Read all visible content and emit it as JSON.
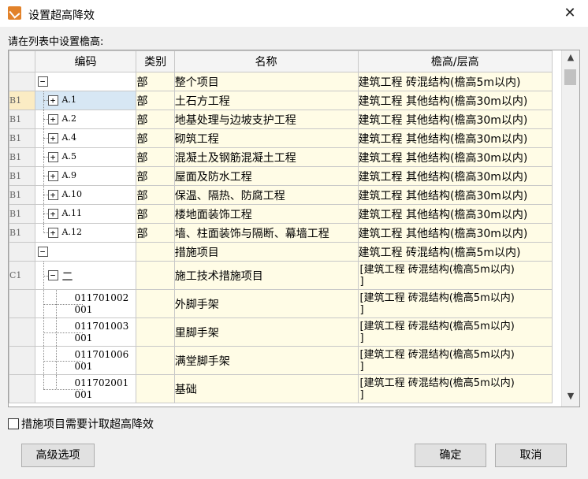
{
  "window": {
    "title": "设置超高降效",
    "close": "✕"
  },
  "prompt": "请在列表中设置檐高:",
  "columns": {
    "code": "编码",
    "type": "类别",
    "name": "名称",
    "height": "檐高/层高"
  },
  "rows": [
    {
      "label": "",
      "toggle": "−",
      "code": "",
      "type": "部",
      "name": "整个项目",
      "height": "建筑工程 砖混结构(檐高5m以内)"
    },
    {
      "label": "B1",
      "toggle": "+",
      "code": "A.1",
      "type": "部",
      "name": "土石方工程",
      "height": "建筑工程 其他结构(檐高30m以内)"
    },
    {
      "label": "B1",
      "toggle": "+",
      "code": "A.2",
      "type": "部",
      "name": "地基处理与边坡支护工程",
      "height": "建筑工程 其他结构(檐高30m以内)"
    },
    {
      "label": "B1",
      "toggle": "+",
      "code": "A.4",
      "type": "部",
      "name": "砌筑工程",
      "height": "建筑工程 其他结构(檐高30m以内)"
    },
    {
      "label": "B1",
      "toggle": "+",
      "code": "A.5",
      "type": "部",
      "name": "混凝土及钢筋混凝土工程",
      "height": "建筑工程 其他结构(檐高30m以内)"
    },
    {
      "label": "B1",
      "toggle": "+",
      "code": "A.9",
      "type": "部",
      "name": "屋面及防水工程",
      "height": "建筑工程 其他结构(檐高30m以内)"
    },
    {
      "label": "B1",
      "toggle": "+",
      "code": "A.10",
      "type": "部",
      "name": "保温、隔热、防腐工程",
      "height": "建筑工程 其他结构(檐高30m以内)"
    },
    {
      "label": "B1",
      "toggle": "+",
      "code": "A.11",
      "type": "部",
      "name": "楼地面装饰工程",
      "height": "建筑工程 其他结构(檐高30m以内)"
    },
    {
      "label": "B1",
      "toggle": "+",
      "code": "A.12",
      "type": "部",
      "name": "墙、柱面装饰与隔断、幕墙工程",
      "height": "建筑工程 其他结构(檐高30m以内)"
    },
    {
      "label": "",
      "toggle": "−",
      "code": "",
      "type": "",
      "name": "措施项目",
      "height": "建筑工程 砖混结构(檐高5m以内)"
    },
    {
      "label": "C1",
      "toggle": "−",
      "code": "二",
      "type": "",
      "name": "施工技术措施项目",
      "height": "[建筑工程 砖混结构(檐高5m以内)\n]"
    },
    {
      "label": "",
      "code1": "011701002",
      "code2": "001",
      "type": "",
      "name": "外脚手架",
      "height": "[建筑工程 砖混结构(檐高5m以内)\n]"
    },
    {
      "label": "",
      "code1": "011701003",
      "code2": "001",
      "type": "",
      "name": "里脚手架",
      "height": "[建筑工程 砖混结构(檐高5m以内)\n]"
    },
    {
      "label": "",
      "code1": "011701006",
      "code2": "001",
      "type": "",
      "name": "满堂脚手架",
      "height": "[建筑工程 砖混结构(檐高5m以内)\n]"
    },
    {
      "label": "",
      "code1": "011702001",
      "code2": "001",
      "type": "",
      "name": "基础",
      "height": "[建筑工程 砖混结构(檐高5m以内)\n]"
    }
  ],
  "checkbox": {
    "label": "措施项目需要计取超高降效",
    "checked": false
  },
  "buttons": {
    "advanced": "高级选项",
    "ok": "确定",
    "cancel": "取消"
  },
  "colors": {
    "header_code": "#f3c87a",
    "cell_bg": "#fffce6",
    "selected": "#d7e7f4"
  }
}
